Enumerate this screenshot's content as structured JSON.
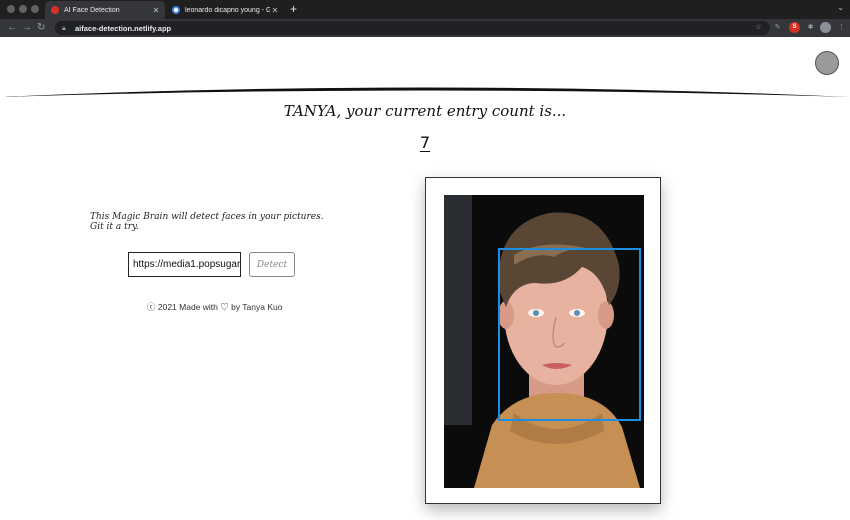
{
  "browser": {
    "tabs": [
      {
        "title": "AI Face Detection",
        "active": true,
        "favicon_color": "#d93025"
      },
      {
        "title": "leonardo dicaprio young - Goo",
        "active": false,
        "favicon_color": "#4285f4"
      }
    ],
    "new_tab_label": "+",
    "url": "aiface-detection.netlify.app"
  },
  "header": {
    "greeting": "TANYA, your current entry count is...",
    "entry_count": "7"
  },
  "form": {
    "intro": "This Magic Brain will detect faces in your pictures. Git it a try.",
    "url_value": "https://media1.popsugar",
    "detect_label": "Detect"
  },
  "footer": {
    "text": "ⓒ 2021 Made with ♡ by Tanya Kuo"
  },
  "colors": {
    "bounding_box": "#1d8fe2",
    "page_background": "#ffffff",
    "chrome_dark": "#1f1f1f"
  }
}
